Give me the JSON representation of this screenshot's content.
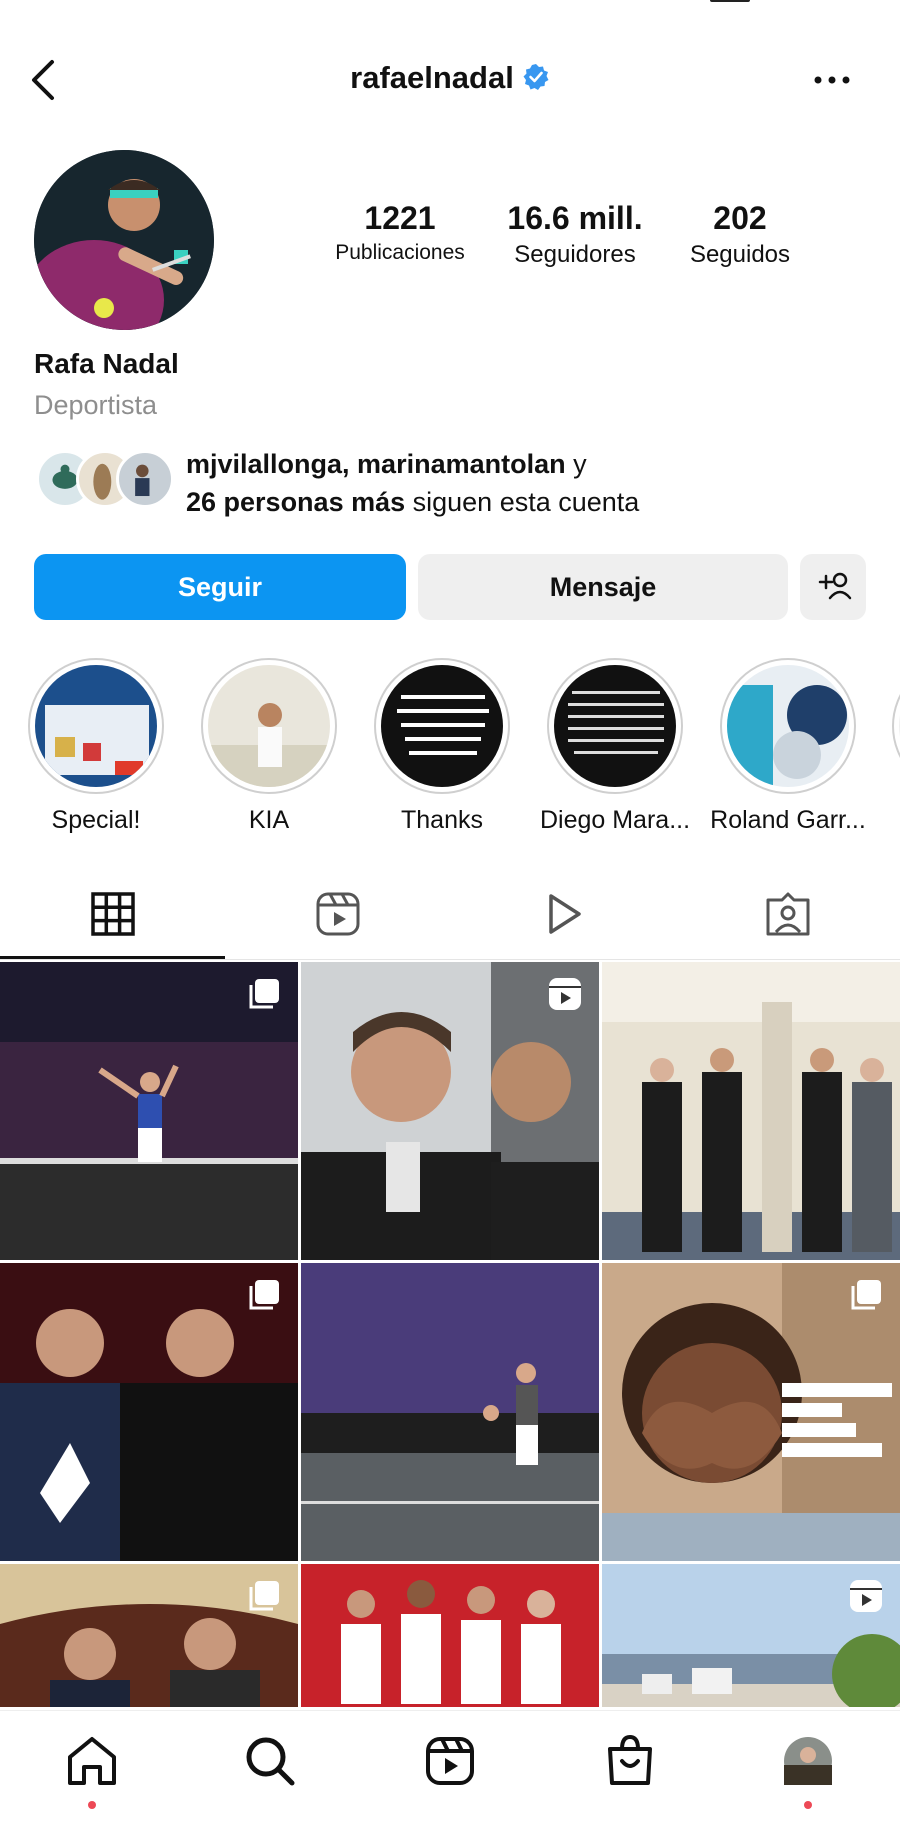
{
  "profile": {
    "username": "rafaelnadal",
    "name": "Rafa Nadal",
    "category": "Deportista"
  },
  "stats": {
    "posts_value": "1221",
    "posts_label": "Publicaciones",
    "followers_value": "16.6 mill.",
    "followers_label": "Seguidores",
    "following_value": "202",
    "following_label": "Seguidos"
  },
  "followed_by": {
    "names": "mjvilallonga, marinamantolan",
    "conj": " y",
    "count_text": "26 personas más",
    "suffix": " siguen esta cuenta"
  },
  "actions": {
    "follow": "Seguir",
    "message": "Mensaje"
  },
  "highlights": [
    {
      "label": "Special!"
    },
    {
      "label": "KIA"
    },
    {
      "label": "Thanks"
    },
    {
      "label": "Diego Mara..."
    },
    {
      "label": "Roland Garr..."
    }
  ],
  "colors": {
    "accent": "#0c95f2",
    "verified": "#3897f0",
    "notification": "#ed4956"
  }
}
